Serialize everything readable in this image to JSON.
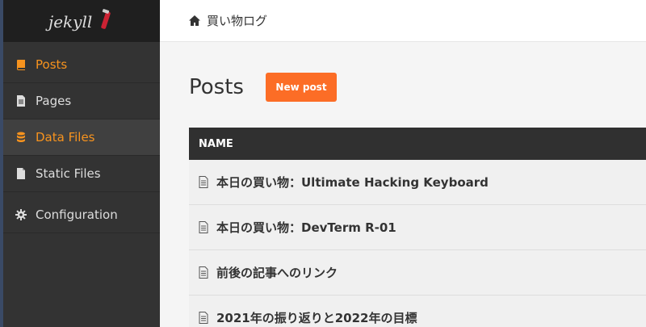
{
  "app": {
    "logo_text": "jekyll"
  },
  "colors": {
    "accent": "#f7931e",
    "button": "#fc6d26",
    "sidebar": "#333333"
  },
  "sidebar": {
    "items": [
      {
        "label": "Posts",
        "icon": "book-icon"
      },
      {
        "label": "Pages",
        "icon": "page-icon"
      },
      {
        "label": "Data Files",
        "icon": "database-icon"
      },
      {
        "label": "Static Files",
        "icon": "file-icon"
      },
      {
        "label": "Configuration",
        "icon": "gear-icon"
      }
    ]
  },
  "header": {
    "site_title": "買い物ログ",
    "icon": "home-icon"
  },
  "main": {
    "title": "Posts",
    "new_button": "New post",
    "table": {
      "header": "NAME",
      "rows": [
        "本日の買い物：Ultimate Hacking Keyboard",
        "本日の買い物：DevTerm R-01",
        "前後の記事へのリンク",
        "2021年の振り返りと2022年の目標"
      ]
    }
  }
}
